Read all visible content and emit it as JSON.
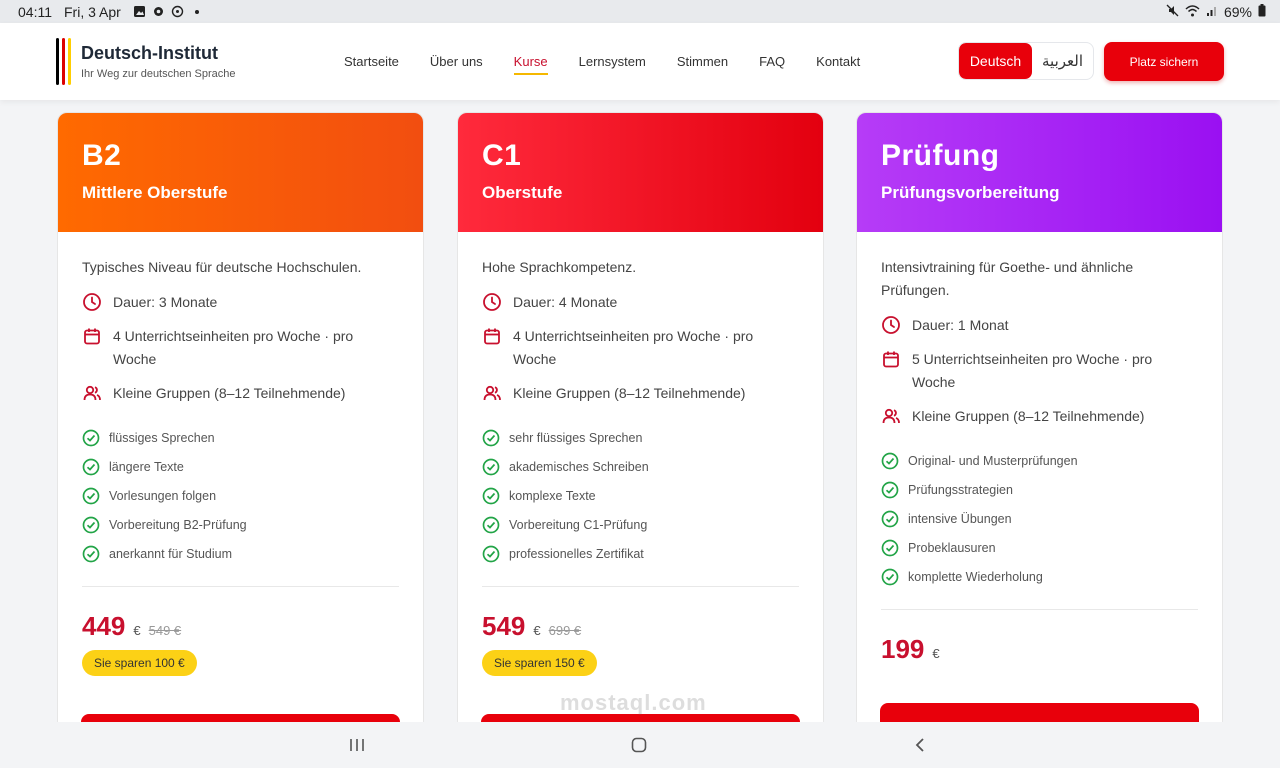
{
  "status": {
    "time": "04:11",
    "date": "Fri, 3 Apr",
    "battery": "69%"
  },
  "header": {
    "brand_name": "Deutsch-Institut",
    "brand_tagline": "Ihr Weg zur deutschen Sprache",
    "flag_colors": [
      "#000000",
      "#dd0000",
      "#ffce00"
    ],
    "nav": [
      "Startseite",
      "Über uns",
      "Kurse",
      "Lernsystem",
      "Stimmen",
      "FAQ",
      "Kontakt"
    ],
    "active_nav": "Kurse",
    "lang_de": "Deutsch",
    "lang_ar": "العربية",
    "cta": "Platz sichern"
  },
  "colors": {
    "primary": "#e8000b",
    "accent": "#f5b800",
    "check": "#22a447"
  },
  "cards": [
    {
      "level": "B2",
      "subtitle": "Mittlere Oberstufe",
      "gradient": [
        "#ff6a00",
        "#f24e10"
      ],
      "description": "Typisches Niveau für deutsche Hochschulen.",
      "duration": "Dauer: 3 Monate",
      "lessons": "4 Unterrichtseinheiten pro Woche · pro Woche",
      "groups": "Kleine Gruppen (8–12 Teilnehmende)",
      "features": [
        "flüssiges Sprechen",
        "längere Texte",
        "Vorlesungen folgen",
        "Vorbereitung B2-Prüfung",
        "anerkannt für Studium"
      ],
      "price": "449",
      "currency": "€",
      "old_price": "549 €",
      "saving": "Sie sparen 100 €"
    },
    {
      "level": "C1",
      "subtitle": "Oberstufe",
      "gradient": [
        "#ff2a3c",
        "#e3000f"
      ],
      "description": "Hohe Sprachkompetenz.",
      "duration": "Dauer: 4 Monate",
      "lessons": "4 Unterrichtseinheiten pro Woche · pro Woche",
      "groups": "Kleine Gruppen (8–12 Teilnehmende)",
      "features": [
        "sehr flüssiges Sprechen",
        "akademisches Schreiben",
        "komplexe Texte",
        "Vorbereitung C1-Prüfung",
        "professionelles Zertifikat"
      ],
      "price": "549",
      "currency": "€",
      "old_price": "699 €",
      "saving": "Sie sparen 150 €"
    },
    {
      "level": "Prüfung",
      "subtitle": "Prüfungsvorbereitung",
      "gradient": [
        "#b63cf7",
        "#9a10f2"
      ],
      "description": "Intensivtraining für Goethe- und ähnliche Prüfungen.",
      "duration": "Dauer: 1 Monat",
      "lessons": "5 Unterrichtseinheiten pro Woche · pro Woche",
      "groups": "Kleine Gruppen (8–12 Teilnehmende)",
      "features": [
        "Original- und Musterprüfungen",
        "Prüfungsstrategien",
        "intensive Übungen",
        "Probeklausuren",
        "komplette Wiederholung"
      ],
      "price": "199",
      "currency": "€"
    }
  ],
  "watermark": "mostaql.com"
}
